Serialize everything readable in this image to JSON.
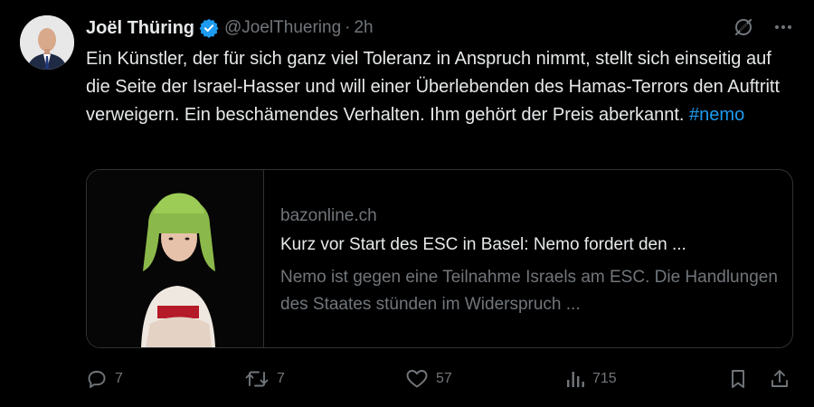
{
  "author": {
    "name": "Joël Thüring",
    "handle": "@JoelThuering",
    "separator": "·",
    "time": "2h",
    "avatar_icon": "profile-photo",
    "verified_icon": "verified-badge-icon",
    "verified_color": "#1d9bf0"
  },
  "tweet": {
    "text_before_hashtag": "Ein Künstler, der für sich ganz viel Toleranz in Anspruch nimmt, stellt sich einseitig auf die Seite der Israel-Hasser und will einer Überlebenden des Hamas-Terrors den Auftritt verweigern. Ein beschämendes Verhalten. Ihm gehört der Preis aberkannt.",
    "hashtag": "#nemo",
    "hashtag_color": "#1d9bf0"
  },
  "card": {
    "domain": "bazonline.ch",
    "title": "Kurz vor Start des ESC in Basel: Nemo fordert den ...",
    "description": "Nemo ist gegen eine Teilnahme Israels am ESC. Die Handlungen des Staates stünden im Widerspruch ..."
  },
  "actions": {
    "replies": "7",
    "reposts": "7",
    "likes": "57",
    "views": "715"
  },
  "icons": {
    "grok": "grok-icon",
    "more": "more-icon",
    "reply": "reply-icon",
    "repost": "repost-icon",
    "like": "heart-icon",
    "views": "views-icon",
    "bookmark": "bookmark-icon",
    "share": "share-icon"
  },
  "colors": {
    "background": "#000000",
    "text": "#e7e9ea",
    "muted": "#71767b",
    "border": "#2f3336"
  }
}
